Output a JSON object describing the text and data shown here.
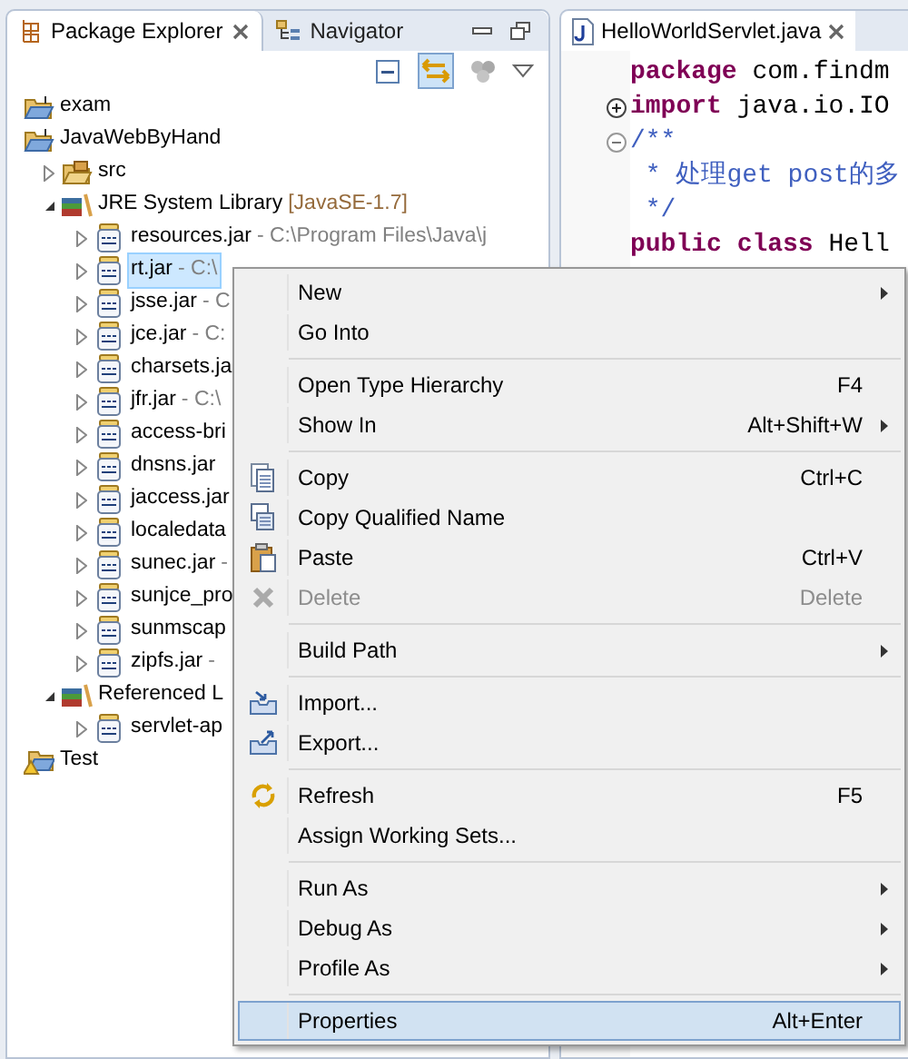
{
  "explorer": {
    "tabs": [
      {
        "label": "Package Explorer",
        "selected": true,
        "closable": true
      },
      {
        "label": "Navigator",
        "selected": false,
        "closable": false
      }
    ],
    "tree": [
      {
        "label": "exam",
        "kind": "project"
      },
      {
        "label": "JavaWebByHand",
        "kind": "project",
        "children": [
          {
            "label": "src",
            "kind": "source-folder",
            "expanded": false
          },
          {
            "label": "JRE System Library",
            "detail": "[JavaSE-1.7]",
            "kind": "library",
            "expanded": true,
            "children": [
              {
                "label": "resources.jar",
                "detail": "- C:\\Program Files\\Java\\j",
                "kind": "jar",
                "expanded": false,
                "selected": false
              },
              {
                "label": "rt.jar",
                "detail": "- C:\\",
                "kind": "jar",
                "expanded": false,
                "selected": true
              },
              {
                "label": "jsse.jar",
                "detail": "- C",
                "kind": "jar",
                "expanded": false,
                "selected": false
              },
              {
                "label": "jce.jar",
                "detail": "- C:",
                "kind": "jar",
                "expanded": false,
                "selected": false
              },
              {
                "label": "charsets.ja",
                "kind": "jar",
                "expanded": false,
                "selected": false
              },
              {
                "label": "jfr.jar",
                "detail": "- C:\\",
                "kind": "jar",
                "expanded": false,
                "selected": false
              },
              {
                "label": "access-bri",
                "kind": "jar",
                "expanded": false,
                "selected": false
              },
              {
                "label": "dnsns.jar",
                "kind": "jar",
                "expanded": false,
                "selected": false
              },
              {
                "label": "jaccess.jar",
                "kind": "jar",
                "expanded": false,
                "selected": false
              },
              {
                "label": "localedata",
                "kind": "jar",
                "expanded": false,
                "selected": false
              },
              {
                "label": "sunec.jar",
                "detail": "-",
                "kind": "jar",
                "expanded": false,
                "selected": false
              },
              {
                "label": "sunjce_pro",
                "kind": "jar",
                "expanded": false,
                "selected": false
              },
              {
                "label": "sunmscap",
                "kind": "jar",
                "expanded": false,
                "selected": false
              },
              {
                "label": "zipfs.jar",
                "detail": "-",
                "kind": "jar",
                "expanded": false,
                "selected": false
              }
            ]
          },
          {
            "label": "Referenced L",
            "kind": "library",
            "expanded": true,
            "children": [
              {
                "label": "servlet-ap",
                "kind": "jar",
                "expanded": false,
                "selected": false
              }
            ]
          }
        ]
      },
      {
        "label": "Test",
        "kind": "project-warning"
      }
    ]
  },
  "editor": {
    "tab": {
      "label": "HelloWorldServlet.java",
      "selected": true
    },
    "lines": [
      {
        "text": "**package** com.findm",
        "kind": "code"
      },
      {
        "text": "**import** java.io.IO",
        "kind": "code",
        "folded": true
      },
      {
        "text": "/**",
        "kind": "comment",
        "folded": false
      },
      {
        "text": " * 处理get post的多",
        "kind": "comment"
      },
      {
        "text": " */",
        "kind": "comment"
      },
      {
        "text": "**public** **class** Hell",
        "kind": "code"
      }
    ]
  },
  "context_menu": [
    {
      "kind": "item",
      "label": "New",
      "submenu": true
    },
    {
      "kind": "item",
      "label": "Go Into"
    },
    {
      "kind": "separator"
    },
    {
      "kind": "item",
      "label": "Open Type Hierarchy",
      "shortcut": "F4"
    },
    {
      "kind": "item",
      "label": "Show In",
      "shortcut": "Alt+Shift+W",
      "submenu": true
    },
    {
      "kind": "separator"
    },
    {
      "kind": "item",
      "label": "Copy",
      "shortcut": "Ctrl+C"
    },
    {
      "kind": "item",
      "label": "Copy Qualified Name"
    },
    {
      "kind": "item",
      "label": "Paste",
      "shortcut": "Ctrl+V"
    },
    {
      "kind": "item",
      "label": "Delete",
      "shortcut": "Delete",
      "disabled": true
    },
    {
      "kind": "separator"
    },
    {
      "kind": "item",
      "label": "Build Path",
      "submenu": true
    },
    {
      "kind": "separator"
    },
    {
      "kind": "item",
      "label": "Import..."
    },
    {
      "kind": "item",
      "label": "Export..."
    },
    {
      "kind": "separator"
    },
    {
      "kind": "item",
      "label": "Refresh",
      "shortcut": "F5"
    },
    {
      "kind": "item",
      "label": "Assign Working Sets..."
    },
    {
      "kind": "separator"
    },
    {
      "kind": "item",
      "label": "Run As",
      "submenu": true
    },
    {
      "kind": "item",
      "label": "Debug As",
      "submenu": true
    },
    {
      "kind": "item",
      "label": "Profile As",
      "submenu": true
    },
    {
      "kind": "separator"
    },
    {
      "kind": "item",
      "label": "Properties",
      "shortcut": "Alt+Enter",
      "selected": true
    }
  ]
}
